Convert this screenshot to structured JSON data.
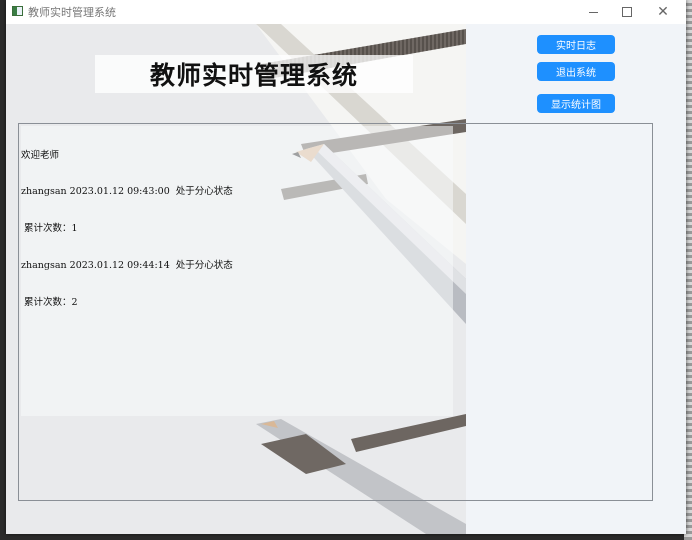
{
  "window": {
    "title": "教师实时管理系统"
  },
  "header": {
    "banner_title": "教师实时管理系统"
  },
  "buttons": {
    "realtime_log": "实时日志",
    "exit_system": "退出系统",
    "show_chart": "显示统计图"
  },
  "log": {
    "lines": [
      "欢迎老师",
      "zhangsan 2023.01.12 09:43:00  处于分心状态",
      " 累计次数：1",
      "zhangsan 2023.01.12 09:44:14  处于分心状态",
      " 累计次数：2"
    ]
  },
  "icons": {
    "app": "app-window-icon",
    "minimize": "minimize-icon",
    "maximize": "maximize-icon",
    "close": "close-icon"
  }
}
